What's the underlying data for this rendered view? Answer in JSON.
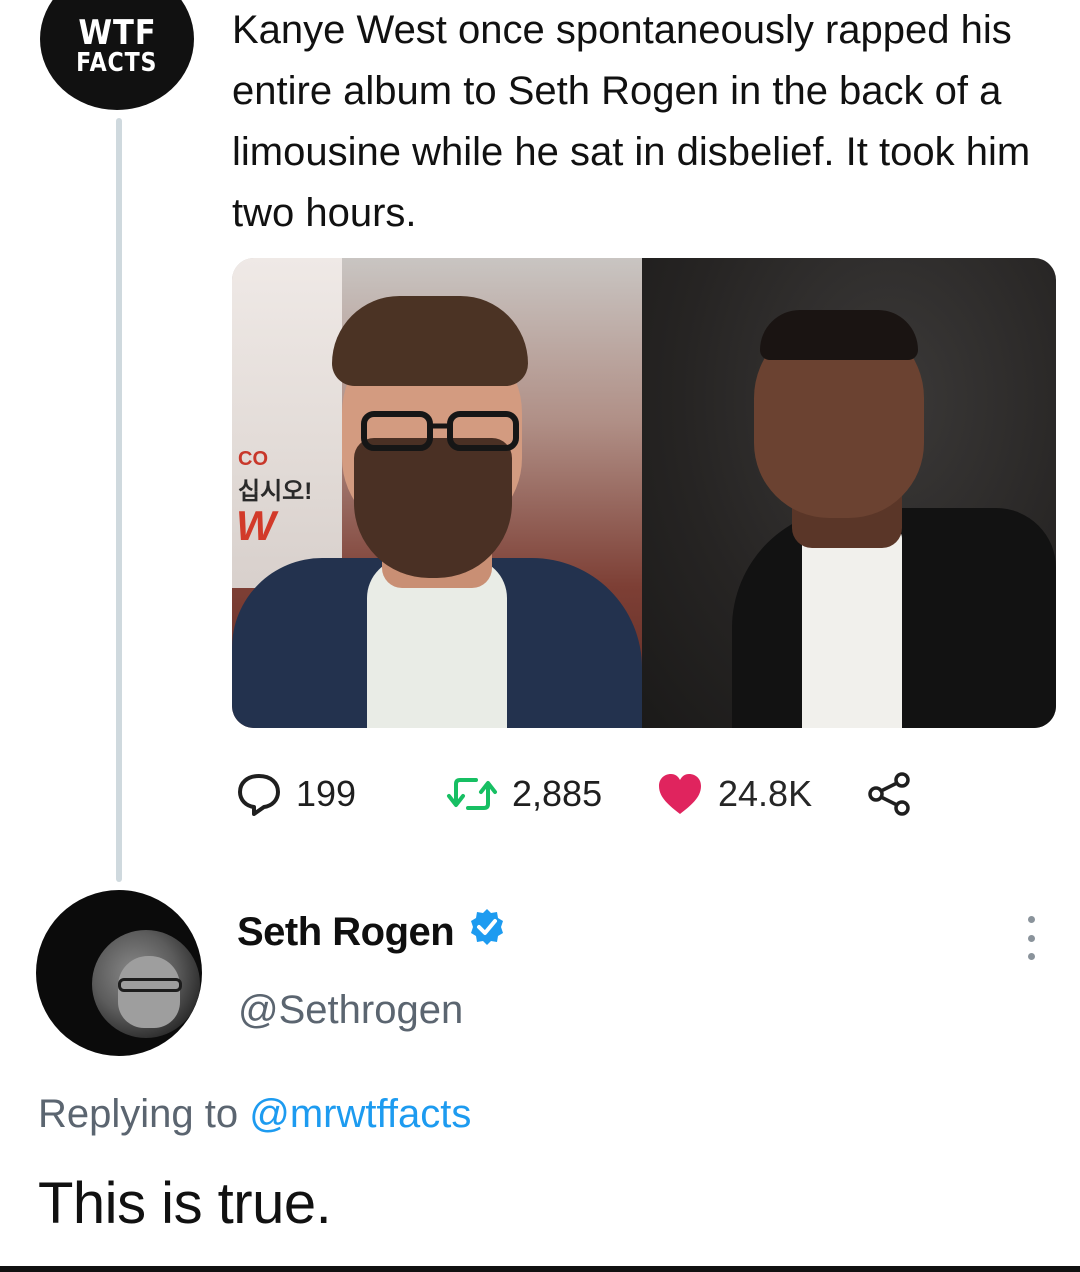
{
  "parent_tweet": {
    "avatar_line1": "WTF",
    "avatar_line2": "FACTS",
    "text": "Kanye West once spontaneously rapped his entire album to Seth Rogen in the back of a limousine while he sat in disbelief. It took him two hours.",
    "media": {
      "left_sign_top": "CO",
      "left_sign_middle": "십시오!",
      "left_sign_logo": "W"
    },
    "stats": {
      "replies": "199",
      "retweets": "2,885",
      "likes": "24.8K"
    },
    "icons": {
      "reply": "speech-bubble-icon",
      "retweet": "retweet-icon",
      "like": "heart-icon",
      "share": "share-icon"
    },
    "colors": {
      "retweet": "#17bf63",
      "like": "#e0245e",
      "thread_line": "#cfd9de"
    }
  },
  "reply_tweet": {
    "display_name": "Seth Rogen",
    "handle": "@Sethrogen",
    "replying_prefix": "Replying to ",
    "replying_handle": "@mrwtffacts",
    "text": "This is true.",
    "icons": {
      "verified": "verified-badge-icon",
      "more": "more-options-icon"
    },
    "colors": {
      "verified": "#1d9bf0",
      "mention": "#1d9bf0",
      "secondary_text": "#5b6570"
    }
  }
}
